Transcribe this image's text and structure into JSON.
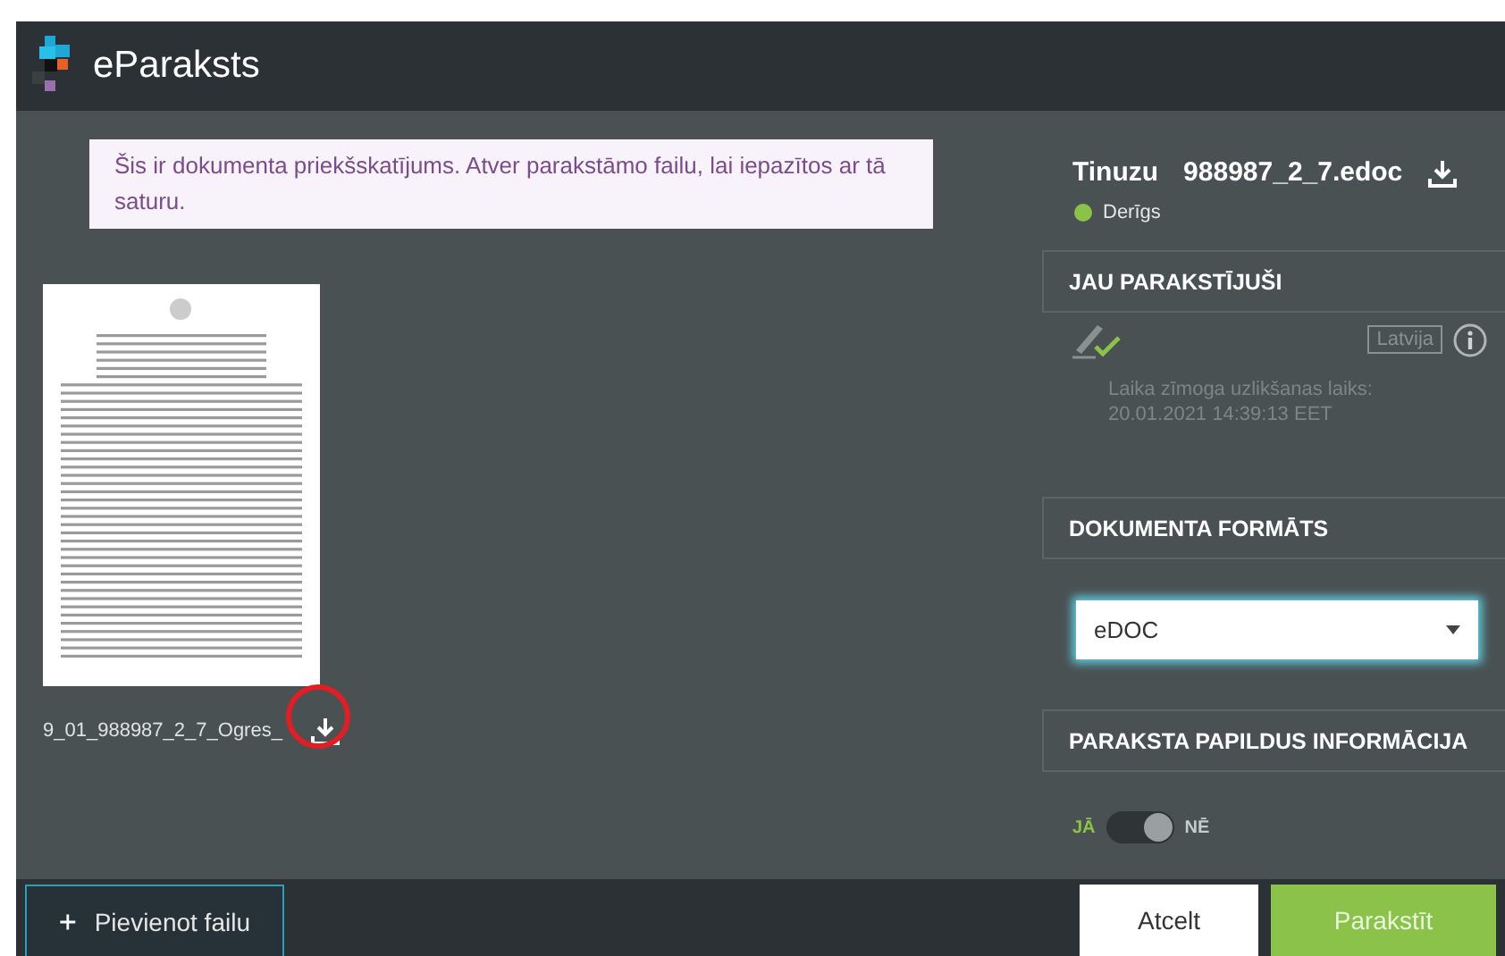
{
  "header": {
    "title": "eParaksts"
  },
  "notice": "Šis ir dokumenta priekšskatījums. Atver parakstāmo failu, lai iepazītos ar tā saturu.",
  "preview": {
    "file_name": "9_01_988987_2_7_Ogres_",
    "download_highlighted": true
  },
  "container": {
    "label": "Tinuzu",
    "file_name": "988987_2_7.edoc",
    "status": {
      "text": "Derīgs",
      "color": "#8bc34a"
    }
  },
  "signed_section": {
    "title": "JAU PARAKSTĪJUŠI",
    "signatures": [
      {
        "valid": true,
        "country": "Latvija",
        "timestamp_label": "Laika zīmoga uzlikšanas laiks:",
        "timestamp": "20.01.2021 14:39:13 EET"
      }
    ]
  },
  "format_section": {
    "title": "DOKUMENTA FORMĀTS",
    "value": "eDOC"
  },
  "extra_section": {
    "title": "PARAKSTA PAPILDUS INFORMĀCIJA",
    "toggle": {
      "on": true,
      "labels": [
        {
          "text": "JĀ",
          "selected": true
        },
        {
          "text": "NĒ",
          "selected": false
        }
      ]
    }
  },
  "footer": {
    "add_button": "Pievienot failu",
    "cancel_button": "Atcelt",
    "sign_button": "Parakstīt"
  }
}
